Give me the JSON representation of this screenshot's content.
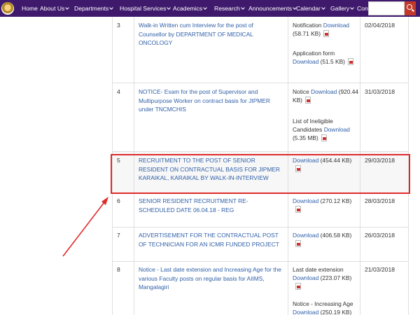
{
  "nav": {
    "items": [
      {
        "label": "Home",
        "dropdown": false
      },
      {
        "label": "About Us",
        "dropdown": true
      },
      {
        "label": "Departments",
        "dropdown": true
      },
      {
        "label": "Hospital Services",
        "dropdown": true
      },
      {
        "label": "Academics",
        "dropdown": true
      },
      {
        "label": "Research",
        "dropdown": true
      },
      {
        "label": "Announcements",
        "dropdown": true
      },
      {
        "label": "Calendar",
        "dropdown": true
      },
      {
        "label": "Gallery",
        "dropdown": true
      },
      {
        "label": "Contact Us",
        "dropdown": false
      }
    ],
    "search_value": ""
  },
  "rows": [
    {
      "no": "3",
      "title": "Walk-in Written cum Interview for the post of Counsellor by DEPARTMENT OF MEDICAL ONCOLOGY",
      "downloads": [
        {
          "prefix": "Notification",
          "link": "Download",
          "size": "(58.71 KB)"
        },
        {
          "prefix": "Application form",
          "link": "Download",
          "size": "(51.5 KB)"
        }
      ],
      "date": "02/04/2018"
    },
    {
      "no": "4",
      "title": "NOTICE- Exam for the post of Supervisor and Multipurpose Worker on contract basis for JIPMER under TNCMCHIS",
      "downloads": [
        {
          "prefix": "Notice",
          "link": "Download",
          "size": "(920.44 KB)"
        },
        {
          "prefix": "List of Ineligible Candidates",
          "link": "Download",
          "size": "(5.35 MB)"
        }
      ],
      "date": "31/03/2018"
    },
    {
      "no": "5",
      "title": "RECRUITMENT TO THE POST OF SENIOR RESIDENT ON CONTRACTUAL BASIS FOR JIPMER KARAIKAL, KARAIKAL BY WALK-IN-INTERVIEW",
      "downloads": [
        {
          "prefix": "",
          "link": "Download",
          "size": "(454.44 KB)"
        }
      ],
      "date": "29/03/2018"
    },
    {
      "no": "6",
      "title": "SENIOR RESIDENT RECRUITMENT RE-SCHEDULED DATE 06.04.18 - REG",
      "downloads": [
        {
          "prefix": "",
          "link": "Download",
          "size": "(270.12 KB)"
        }
      ],
      "date": "28/03/2018"
    },
    {
      "no": "7",
      "title": "ADVERTISEMENT FOR THE CONTRACTUAL POST OF TECHNICIAN FOR AN ICMR FUNDED PROJECT",
      "downloads": [
        {
          "prefix": "",
          "link": "Download",
          "size": "(406.58 KB)"
        }
      ],
      "date": "26/03/2018"
    },
    {
      "no": "8",
      "title": "Notice - Last date extension and Increasing Age for the various Faculty posts on regular basis for AIIMS, Mangalagiri",
      "downloads": [
        {
          "prefix": "Last date extension",
          "link": "Download",
          "size": "(223.07 KB)"
        },
        {
          "prefix": "Notice - Increasing Age",
          "link": "Download",
          "size": "(250.19 KB)"
        }
      ],
      "date": "21/03/2018"
    }
  ],
  "colors": {
    "nav_bg": "#3f1a6c",
    "link": "#2f5fa8",
    "highlight": "#e02b2b",
    "search_button": "#c0392b"
  }
}
